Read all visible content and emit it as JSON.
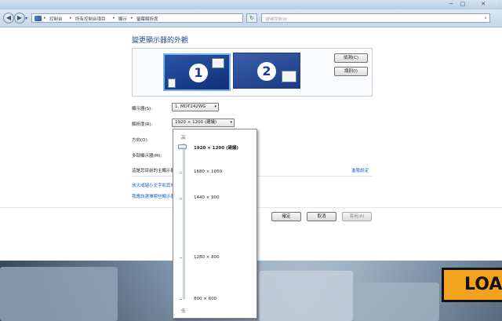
{
  "window": {
    "minimize": "─",
    "maximize": "□",
    "close": "✕"
  },
  "nav": {
    "back": "◀",
    "forward": "▶",
    "dropdown": "▾",
    "refresh": "↻"
  },
  "address": {
    "crumbs": [
      "控制台",
      "所有控制台項目",
      "顯示",
      "螢幕解析度"
    ],
    "separator": "▸",
    "dropdown": "▾"
  },
  "search": {
    "placeholder": "搜尋控制台",
    "icon": "⌕"
  },
  "page": {
    "heading": "變更顯示器的外觀",
    "monitors": [
      "1",
      "2"
    ],
    "detect_button": "偵測(C)",
    "identify_button": "識別(I)",
    "labels": {
      "display": "顯示器(S):",
      "resolution": "解析度(R):",
      "orientation": "方向(O):",
      "multi": "多部顯示器(M):",
      "main_display": "這是您目前的主顯示器。"
    },
    "display_value": "1. MDT242WG",
    "resolution_value": "1920 × 1200 (建議)",
    "advanced_link": "進階設定",
    "links": [
      "放大或縮小文字和其他項目",
      "我應該選擇哪些顯示器設定?"
    ],
    "ok_button": "確定",
    "cancel_button": "取消",
    "apply_button": "套用(A)"
  },
  "resolution_slider": {
    "high_label": "高",
    "low_label": "低",
    "options": [
      "1920 × 1200 (建議)",
      "1680 × 1050",
      "1440 × 900",
      "1280 × 800",
      "800 × 600"
    ],
    "selected_index": 0
  },
  "background": {
    "banner_text": "LOA"
  }
}
